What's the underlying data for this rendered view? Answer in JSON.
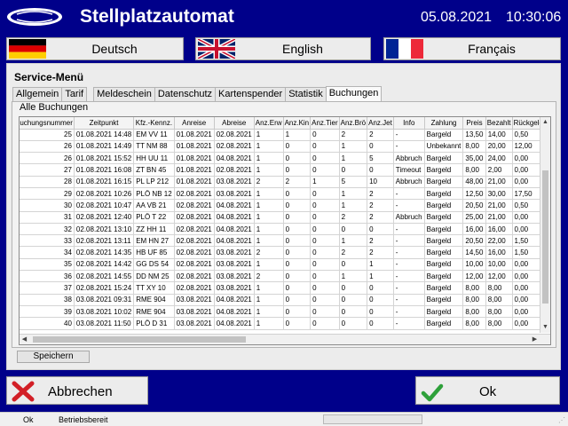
{
  "header": {
    "title": "Stellplatzautomat",
    "date": "05.08.2021",
    "time": "10:30:06"
  },
  "languages": [
    {
      "label": "Deutsch",
      "flag": "german-flag-icon"
    },
    {
      "label": "English",
      "flag": "uk-flag-icon"
    },
    {
      "label": "Français",
      "flag": "french-flag-icon"
    }
  ],
  "panel": {
    "title": "Service-Menü",
    "tabs": [
      "Allgemein",
      "Tarif",
      "Meldeschein",
      "Datenschutz",
      "Kartenspender",
      "Statistik",
      "Buchungen"
    ],
    "active_tab": "Buchungen",
    "group_title": "Alle Buchungen",
    "save_label": "Speichern"
  },
  "table": {
    "columns": [
      "Buchungsnummer",
      "Zeitpunkt",
      "Kfz.-Kennz.",
      "Anreise",
      "Abreise",
      "Anz.Erw",
      "Anz.Kin",
      "Anz.Tier",
      "Anz.Brö",
      "Anz.Jet",
      "Info",
      "Zahlung",
      "Preis",
      "Bezahlt",
      "Rückgeld"
    ],
    "rows": [
      [
        "25",
        "01.08.2021 14:48",
        "EM VV 11",
        "01.08.2021",
        "02.08.2021",
        "1",
        "1",
        "0",
        "2",
        "2",
        "-",
        "Bargeld",
        "13,50",
        "14,00",
        "0,50"
      ],
      [
        "26",
        "01.08.2021 14:49",
        "TT NM 88",
        "01.08.2021",
        "02.08.2021",
        "1",
        "0",
        "0",
        "1",
        "0",
        "-",
        "Unbekannt",
        "8,00",
        "20,00",
        "12,00"
      ],
      [
        "26",
        "01.08.2021 15:52",
        "HH UU 11",
        "01.08.2021",
        "04.08.2021",
        "1",
        "0",
        "0",
        "1",
        "5",
        "Abbruch",
        "Bargeld",
        "35,00",
        "24,00",
        "0,00"
      ],
      [
        "27",
        "01.08.2021 16:08",
        "ZT BN 45",
        "01.08.2021",
        "02.08.2021",
        "1",
        "0",
        "0",
        "0",
        "0",
        "Timeout",
        "Bargeld",
        "8,00",
        "2,00",
        "0,00"
      ],
      [
        "28",
        "01.08.2021 16:15",
        "PL LP 212",
        "01.08.2021",
        "03.08.2021",
        "2",
        "2",
        "1",
        "5",
        "10",
        "Abbruch",
        "Bargeld",
        "48,00",
        "21,00",
        "0,00"
      ],
      [
        "29",
        "02.08.2021 10:26",
        "PLÖ NB 12",
        "02.08.2021",
        "03.08.2021",
        "1",
        "0",
        "0",
        "1",
        "2",
        "-",
        "Bargeld",
        "12,50",
        "30,00",
        "17,50"
      ],
      [
        "30",
        "02.08.2021 10:47",
        "AA VB 21",
        "02.08.2021",
        "04.08.2021",
        "1",
        "0",
        "0",
        "1",
        "2",
        "-",
        "Bargeld",
        "20,50",
        "21,00",
        "0,50"
      ],
      [
        "31",
        "02.08.2021 12:40",
        "PLÖ T 22",
        "02.08.2021",
        "04.08.2021",
        "1",
        "0",
        "0",
        "2",
        "2",
        "Abbruch",
        "Bargeld",
        "25,00",
        "21,00",
        "0,00"
      ],
      [
        "32",
        "02.08.2021 13:10",
        "ZZ HH 11",
        "02.08.2021",
        "04.08.2021",
        "1",
        "0",
        "0",
        "0",
        "0",
        "-",
        "Bargeld",
        "16,00",
        "16,00",
        "0,00"
      ],
      [
        "33",
        "02.08.2021 13:11",
        "EM HN 27",
        "02.08.2021",
        "04.08.2021",
        "1",
        "0",
        "0",
        "1",
        "2",
        "-",
        "Bargeld",
        "20,50",
        "22,00",
        "1,50"
      ],
      [
        "34",
        "02.08.2021 14:35",
        "HB UF 85",
        "02.08.2021",
        "03.08.2021",
        "2",
        "0",
        "0",
        "2",
        "2",
        "-",
        "Bargeld",
        "14,50",
        "16,00",
        "1,50"
      ],
      [
        "35",
        "02.08.2021 14:42",
        "GG DS 54",
        "02.08.2021",
        "03.08.2021",
        "1",
        "0",
        "0",
        "0",
        "1",
        "-",
        "Bargeld",
        "10,00",
        "10,00",
        "0,00"
      ],
      [
        "36",
        "02.08.2021 14:55",
        "DD NM 25",
        "02.08.2021",
        "03.08.2021",
        "2",
        "0",
        "0",
        "1",
        "1",
        "-",
        "Bargeld",
        "12,00",
        "12,00",
        "0,00"
      ],
      [
        "37",
        "02.08.2021 15:24",
        "TT XY 10",
        "02.08.2021",
        "03.08.2021",
        "1",
        "0",
        "0",
        "0",
        "0",
        "-",
        "Bargeld",
        "8,00",
        "8,00",
        "0,00"
      ],
      [
        "38",
        "03.08.2021 09:31",
        "RME 904",
        "03.08.2021",
        "04.08.2021",
        "1",
        "0",
        "0",
        "0",
        "0",
        "-",
        "Bargeld",
        "8,00",
        "8,00",
        "0,00"
      ],
      [
        "39",
        "03.08.2021 10:02",
        "RME 904",
        "03.08.2021",
        "04.08.2021",
        "1",
        "0",
        "0",
        "0",
        "0",
        "-",
        "Bargeld",
        "8,00",
        "8,00",
        "0,00"
      ],
      [
        "40",
        "03.08.2021 11:50",
        "PLÖ D 31",
        "03.08.2021",
        "04.08.2021",
        "1",
        "0",
        "0",
        "0",
        "0",
        "-",
        "Bargeld",
        "8,00",
        "8,00",
        "0,00"
      ]
    ]
  },
  "buttons": {
    "cancel_label": "Abbrechen",
    "ok_label": "Ok"
  },
  "status": {
    "state": "Ok",
    "message": "Betriebsbereit"
  },
  "colors": {
    "background": "#00008a",
    "panel": "#ececec",
    "cancel_icon": "#d21f26",
    "ok_icon": "#2ea03a"
  }
}
